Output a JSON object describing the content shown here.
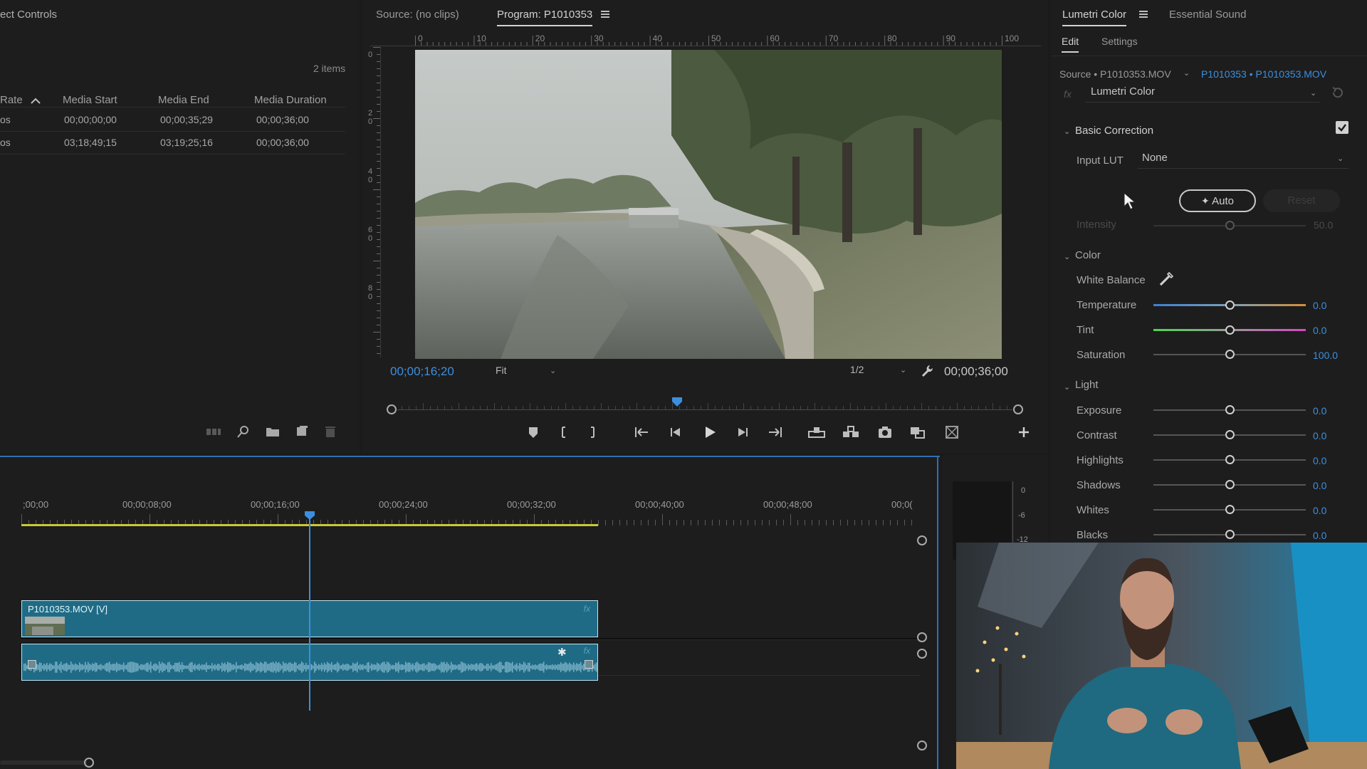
{
  "project_panel": {
    "title": "ect Controls",
    "items_count": "2 items",
    "columns": [
      "Rate",
      "Media Start",
      "Media End",
      "Media Duration"
    ],
    "rows": [
      {
        "rate": "os",
        "start": "00;00;00;00",
        "end": "00;00;35;29",
        "duration": "00;00;36;00"
      },
      {
        "rate": "os",
        "start": "03;18;49;15",
        "end": "03;19;25;16",
        "duration": "00;00;36;00"
      }
    ]
  },
  "program_monitor": {
    "source_tab": "Source: (no clips)",
    "program_tab": "Program: P1010353",
    "ruler_ticks": [
      "0",
      "10",
      "20",
      "30",
      "40",
      "50",
      "60",
      "70",
      "80",
      "90",
      "100"
    ],
    "vruler_ticks": [
      "0",
      "2\n0",
      "4\n0",
      "6\n0",
      "8\n0"
    ],
    "current_time": "00;00;16;20",
    "fit_label": "Fit",
    "resolution": "1/2",
    "duration": "00;00;36;00",
    "playhead_fraction": 0.455
  },
  "lumetri": {
    "tab_lumetri": "Lumetri Color",
    "tab_sound": "Essential Sound",
    "subtab_edit": "Edit",
    "subtab_settings": "Settings",
    "source_label": "Source • P1010353.MOV",
    "clip_label": "P1010353 • P1010353.MOV",
    "fx_label": "fx",
    "effect_name": "Lumetri Color",
    "basic_correction": "Basic Correction",
    "input_lut_label": "Input LUT",
    "input_lut_value": "None",
    "auto_button": "Auto",
    "reset_button": "Reset",
    "intensity_label": "Intensity",
    "intensity_value": "50.0",
    "color_section": "Color",
    "white_balance_label": "White Balance",
    "temperature": {
      "label": "Temperature",
      "value": "0.0"
    },
    "tint": {
      "label": "Tint",
      "value": "0.0"
    },
    "saturation": {
      "label": "Saturation",
      "value": "100.0"
    },
    "light_section": "Light",
    "light_sliders": [
      {
        "label": "Exposure",
        "value": "0.0"
      },
      {
        "label": "Contrast",
        "value": "0.0"
      },
      {
        "label": "Highlights",
        "value": "0.0"
      },
      {
        "label": "Shadows",
        "value": "0.0"
      },
      {
        "label": "Whites",
        "value": "0.0"
      },
      {
        "label": "Blacks",
        "value": "0.0"
      }
    ]
  },
  "timeline": {
    "timecodes": [
      ";00;00",
      "00;00;08;00",
      "00;00;16;00",
      "00;00;24;00",
      "00;00;32;00",
      "00;00;40;00",
      "00;00;48;00",
      "00;0("
    ],
    "video_clip_label": "P1010353.MOV [V]",
    "fx_badge": "fx",
    "playhead_time_fraction": 0.463
  },
  "audio_meter": {
    "ticks": [
      "0",
      "-6",
      "-12"
    ]
  },
  "colors": {
    "accent_blue": "#3c8fe0",
    "clip_teal": "#1f6b86",
    "work_area_yellow": "#c9c83a"
  }
}
